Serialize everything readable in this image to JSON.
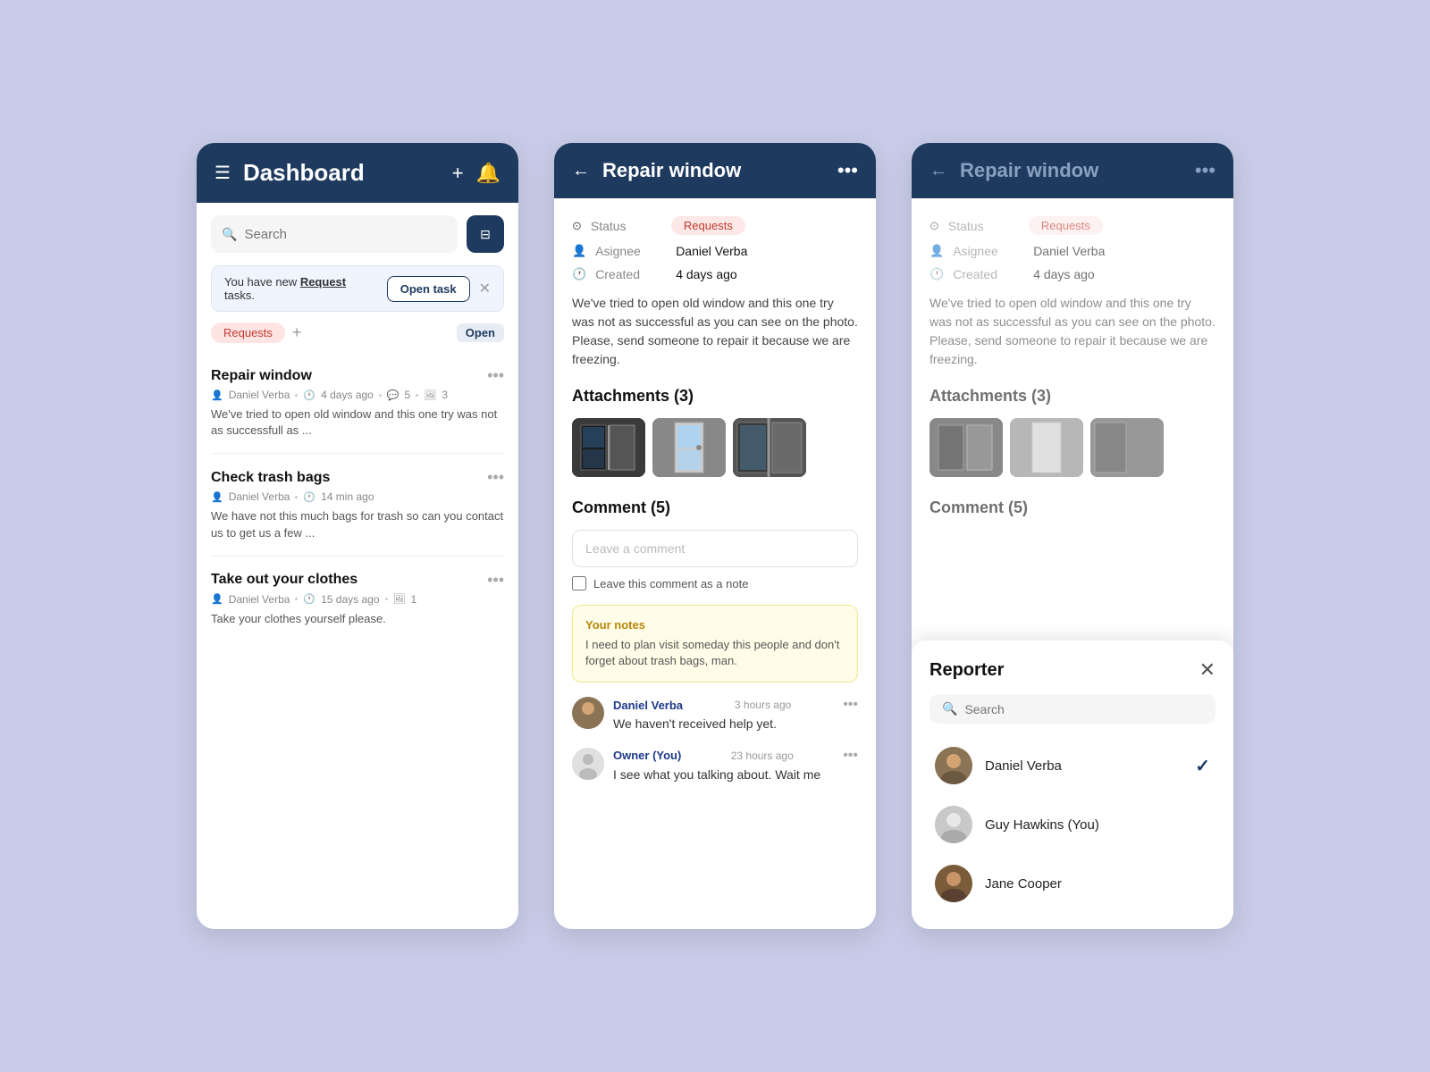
{
  "colors": {
    "header_bg": "#1e3a5f",
    "body_bg": "#c8cce8",
    "accent_red": "#c0392b",
    "accent_yellow": "#fffde8"
  },
  "panel1": {
    "header": {
      "title": "Dashboard"
    },
    "search": {
      "placeholder": "Search"
    },
    "notification": {
      "text_prefix": "You have new ",
      "text_link": "Request",
      "text_suffix": " tasks.",
      "open_task_btn": "Open task"
    },
    "category": {
      "tag": "Requests",
      "open_label": "Open"
    },
    "tasks": [
      {
        "title": "Repair window",
        "assignee": "Daniel Verba",
        "time": "4 days ago",
        "comments": "5",
        "photos": "3",
        "desc": "We've tried to open old window and this one try was not as successfull as ..."
      },
      {
        "title": "Check trash bags",
        "assignee": "Daniel Verba",
        "time": "14 min ago",
        "desc": "We have not this much bags for trash so can you contact us to get us a few ..."
      },
      {
        "title": "Take out your clothes",
        "assignee": "Daniel Verba",
        "time": "15 days ago",
        "photos": "1",
        "desc": "Take your clothes yourself please."
      }
    ]
  },
  "panel2": {
    "header": {
      "title": "Repair window"
    },
    "status_label": "Status",
    "status_value": "Requests",
    "assignee_label": "Asignee",
    "assignee_value": "Daniel Verba",
    "created_label": "Created",
    "created_value": "4 days ago",
    "description": "We've tried to open old window and this one try was not as successful as you can see on the photo. Please, send someone to repair it because we are freezing.",
    "attachments_title": "Attachments (3)",
    "comments_title": "Comment (5)",
    "comment_placeholder": "Leave a comment",
    "note_checkbox_label": "Leave this comment as a note",
    "your_notes": {
      "title": "Your notes",
      "text": "I need to plan visit someday this people and don't forget about trash bags, man."
    },
    "comments": [
      {
        "name": "Daniel Verba",
        "time": "3 hours ago",
        "text": "We haven't received help yet.",
        "type": "daniel"
      },
      {
        "name": "Owner (You)",
        "time": "23 hours ago",
        "text": "I see what you talking about. Wait me",
        "type": "owner"
      }
    ]
  },
  "panel3": {
    "header": {
      "title": "Repair window"
    },
    "status_label": "Status",
    "status_value": "Requests",
    "assignee_label": "Asignee",
    "assignee_value": "Daniel Verba",
    "created_label": "Created",
    "created_value": "4 days ago",
    "description": "We've tried to open old window and this one try was not as successful as you can see on the photo. Please, send someone to repair it because we are freezing.",
    "attachments_title": "Attachments (3)",
    "comments_title": "Comment (5)"
  },
  "reporter_overlay": {
    "title": "Reporter",
    "search_placeholder": "Search",
    "people": [
      {
        "name": "Daniel Verba",
        "selected": true,
        "type": "daniel-r"
      },
      {
        "name": "Guy Hawkins (You)",
        "selected": false,
        "type": "guy-r"
      },
      {
        "name": "Jane Cooper",
        "selected": false,
        "type": "jane-r"
      }
    ]
  }
}
